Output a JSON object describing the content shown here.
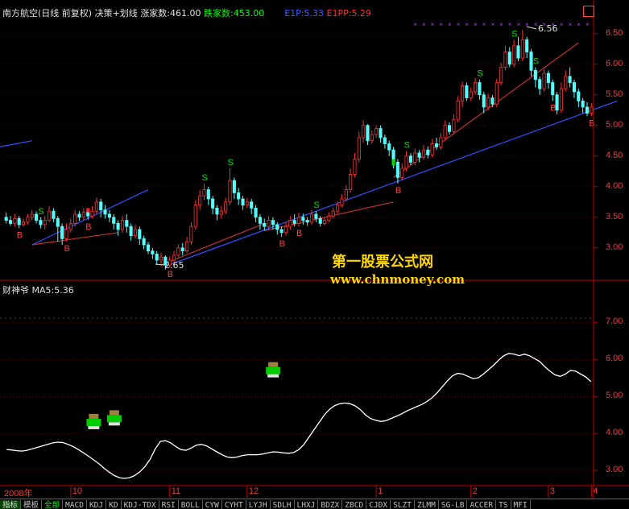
{
  "header": {
    "stock_title": "南方航空(日线 前复权)",
    "indicator_name": "决策+划线",
    "rise_count": "涨家数:461.00",
    "fall_count": "跌家数:453.00",
    "e1p": "E1P:5.33",
    "e1pp": "E1PP:5.29",
    "max_button": "□"
  },
  "sub_header": {
    "indicator": "财神爷",
    "ma_value": "MA5:5.36"
  },
  "watermark": {
    "line1": "第一股票公式网",
    "line2": "www.chnmoney.com"
  },
  "annotations": {
    "high": "6.56",
    "low": "2.65"
  },
  "time_axis": [
    "2008年",
    "10",
    "11",
    "12",
    "1",
    "2",
    "3",
    "4"
  ],
  "tabs": [
    "指标",
    "模板",
    "全部",
    "MACD",
    "KDJ",
    "KD",
    "KDJ-TDX",
    "RSI",
    "BOLL",
    "CYW",
    "CYHT",
    "LYJH",
    "SDLH",
    "LHXJ",
    "BDZX",
    "ZBCD",
    "CJDX",
    "SLZT",
    "ZLMM",
    "SG-LB",
    "ACCER",
    "TS",
    "MFI"
  ],
  "colors": {
    "up": "#ff3333",
    "down": "#54ffff",
    "axis": "#c00000",
    "ma_line": "#ffffff",
    "trend_blue": "#3050ff",
    "trend_red": "#c03030",
    "signal_s": "#00e000",
    "signal_b": "#ff4040"
  },
  "chart_data": [
    {
      "type": "candlestick",
      "title": "",
      "y_ticks": [
        3.0,
        3.5,
        4.0,
        4.5,
        5.0,
        5.5,
        6.0,
        6.5
      ],
      "ylim": [
        2.55,
        6.72
      ],
      "x_ticks": [
        "2008年",
        "10",
        "11",
        "12",
        "1",
        "2",
        "3",
        "4"
      ],
      "candles": [
        [
          3.5,
          3.45,
          3.58,
          3.4
        ],
        [
          3.45,
          3.4,
          3.52,
          3.36
        ],
        [
          3.4,
          3.48,
          3.55,
          3.35
        ],
        [
          3.48,
          3.38,
          3.52,
          3.32
        ],
        [
          3.38,
          3.42,
          3.48,
          3.35
        ],
        [
          3.42,
          3.5,
          3.55,
          3.38
        ],
        [
          3.5,
          3.55,
          3.62,
          3.45
        ],
        [
          3.55,
          3.45,
          3.6,
          3.4
        ],
        [
          3.45,
          3.38,
          3.5,
          3.32
        ],
        [
          3.38,
          3.45,
          3.52,
          3.3
        ],
        [
          3.45,
          3.6,
          3.68,
          3.42
        ],
        [
          3.6,
          3.48,
          3.65,
          3.42
        ],
        [
          3.48,
          3.35,
          3.52,
          3.1
        ],
        [
          3.35,
          3.15,
          3.4,
          3.05
        ],
        [
          3.15,
          3.3,
          3.4,
          3.1
        ],
        [
          3.3,
          3.4,
          3.48,
          3.25
        ],
        [
          3.4,
          3.55,
          3.62,
          3.35
        ],
        [
          3.55,
          3.5,
          3.6,
          3.44
        ],
        [
          3.5,
          3.58,
          3.65,
          3.45
        ],
        [
          3.58,
          3.52,
          3.64,
          3.46
        ],
        [
          3.52,
          3.6,
          3.68,
          3.48
        ],
        [
          3.6,
          3.75,
          3.82,
          3.55
        ],
        [
          3.75,
          3.62,
          3.8,
          3.5
        ],
        [
          3.62,
          3.55,
          3.7,
          3.48
        ],
        [
          3.55,
          3.5,
          3.62,
          3.42
        ],
        [
          3.5,
          3.4,
          3.55,
          3.3
        ],
        [
          3.4,
          3.3,
          3.45,
          3.2
        ],
        [
          3.3,
          3.45,
          3.52,
          3.25
        ],
        [
          3.45,
          3.35,
          3.55,
          3.25
        ],
        [
          3.35,
          3.2,
          3.4,
          3.12
        ],
        [
          3.2,
          3.3,
          3.38,
          3.15
        ],
        [
          3.3,
          3.15,
          3.35,
          3.05
        ],
        [
          3.15,
          3.05,
          3.2,
          2.98
        ],
        [
          3.05,
          2.95,
          3.1,
          2.9
        ],
        [
          2.95,
          2.9,
          3.0,
          2.82
        ],
        [
          2.9,
          2.8,
          2.95,
          2.72
        ],
        [
          2.8,
          2.85,
          2.92,
          2.7
        ],
        [
          2.85,
          2.72,
          2.88,
          2.65
        ],
        [
          2.72,
          2.8,
          2.86,
          2.68
        ],
        [
          2.8,
          2.88,
          2.95,
          2.75
        ],
        [
          2.88,
          3.0,
          3.06,
          2.85
        ],
        [
          3.0,
          2.95,
          3.08,
          2.88
        ],
        [
          2.95,
          3.1,
          3.18,
          2.92
        ],
        [
          3.1,
          3.35,
          3.42,
          3.05
        ],
        [
          3.35,
          3.7,
          3.78,
          3.3
        ],
        [
          3.7,
          3.85,
          3.95,
          3.62
        ],
        [
          3.85,
          3.95,
          4.05,
          3.78
        ],
        [
          3.95,
          3.8,
          4.0,
          3.7
        ],
        [
          3.8,
          3.65,
          3.85,
          3.55
        ],
        [
          3.65,
          3.55,
          3.7,
          3.45
        ],
        [
          3.55,
          3.6,
          3.68,
          3.48
        ],
        [
          3.6,
          3.75,
          3.82,
          3.55
        ],
        [
          3.75,
          4.1,
          4.3,
          3.7
        ],
        [
          4.1,
          3.9,
          4.15,
          3.8
        ],
        [
          3.9,
          3.8,
          3.98,
          3.7
        ],
        [
          3.8,
          3.7,
          3.85,
          3.62
        ],
        [
          3.7,
          3.75,
          3.82,
          3.65
        ],
        [
          3.75,
          3.65,
          3.8,
          3.55
        ],
        [
          3.65,
          3.5,
          3.7,
          3.42
        ],
        [
          3.5,
          3.4,
          3.55,
          3.3
        ],
        [
          3.4,
          3.35,
          3.48,
          3.28
        ],
        [
          3.35,
          3.45,
          3.52,
          3.3
        ],
        [
          3.45,
          3.38,
          3.5,
          3.3
        ],
        [
          3.38,
          3.3,
          3.42,
          3.22
        ],
        [
          3.3,
          3.25,
          3.35,
          3.18
        ],
        [
          3.25,
          3.35,
          3.42,
          3.2
        ],
        [
          3.35,
          3.45,
          3.52,
          3.3
        ],
        [
          3.45,
          3.4,
          3.55,
          3.35
        ],
        [
          3.4,
          3.5,
          3.58,
          3.35
        ],
        [
          3.5,
          3.45,
          3.56,
          3.38
        ],
        [
          3.45,
          3.42,
          3.5,
          3.36
        ],
        [
          3.42,
          3.55,
          3.62,
          3.38
        ],
        [
          3.55,
          3.48,
          3.6,
          3.42
        ],
        [
          3.48,
          3.4,
          3.52,
          3.35
        ],
        [
          3.4,
          3.45,
          3.5,
          3.36
        ],
        [
          3.45,
          3.52,
          3.58,
          3.42
        ],
        [
          3.52,
          3.6,
          3.66,
          3.48
        ],
        [
          3.6,
          3.7,
          3.76,
          3.56
        ],
        [
          3.7,
          3.8,
          3.88,
          3.66
        ],
        [
          3.8,
          3.95,
          4.02,
          3.76
        ],
        [
          3.95,
          4.2,
          4.3,
          3.9
        ],
        [
          4.2,
          4.45,
          4.55,
          4.15
        ],
        [
          4.45,
          4.8,
          4.9,
          4.4
        ],
        [
          4.8,
          5.0,
          5.08,
          4.72
        ],
        [
          5.0,
          4.75,
          5.02,
          4.68
        ],
        [
          4.75,
          4.85,
          4.92,
          4.7
        ],
        [
          4.85,
          4.95,
          5.0,
          4.8
        ],
        [
          4.95,
          4.8,
          5.0,
          4.72
        ],
        [
          4.8,
          4.7,
          4.85,
          4.62
        ],
        [
          4.7,
          4.6,
          4.75,
          4.5
        ],
        [
          4.6,
          4.4,
          4.65,
          4.3
        ],
        [
          4.4,
          4.15,
          4.45,
          4.05
        ],
        [
          4.15,
          4.3,
          4.38,
          4.1
        ],
        [
          4.3,
          4.5,
          4.58,
          4.25
        ],
        [
          4.5,
          4.4,
          4.55,
          4.35
        ],
        [
          4.4,
          4.55,
          4.62,
          4.35
        ],
        [
          4.55,
          4.48,
          4.6,
          4.4
        ],
        [
          4.48,
          4.6,
          4.68,
          4.44
        ],
        [
          4.6,
          4.52,
          4.66,
          4.46
        ],
        [
          4.52,
          4.7,
          4.78,
          4.48
        ],
        [
          4.7,
          4.65,
          4.8,
          4.6
        ],
        [
          4.65,
          4.8,
          4.88,
          4.6
        ],
        [
          4.8,
          5.0,
          5.08,
          4.75
        ],
        [
          5.0,
          4.9,
          5.05,
          4.85
        ],
        [
          4.9,
          5.1,
          5.18,
          4.85
        ],
        [
          5.1,
          5.4,
          5.48,
          5.05
        ],
        [
          5.4,
          5.65,
          5.72,
          5.3
        ],
        [
          5.65,
          5.45,
          5.7,
          5.4
        ],
        [
          5.45,
          5.55,
          5.62,
          5.4
        ],
        [
          5.55,
          5.7,
          5.78,
          5.5
        ],
        [
          5.7,
          5.5,
          5.75,
          5.42
        ],
        [
          5.5,
          5.3,
          5.55,
          5.2
        ],
        [
          5.3,
          5.45,
          5.52,
          5.25
        ],
        [
          5.45,
          5.35,
          5.5,
          5.3
        ],
        [
          5.35,
          5.7,
          5.76,
          5.3
        ],
        [
          5.7,
          5.95,
          6.02,
          5.65
        ],
        [
          5.95,
          6.2,
          6.3,
          5.9
        ],
        [
          6.2,
          6.0,
          6.28,
          5.95
        ],
        [
          6.0,
          6.3,
          6.4,
          5.95
        ],
        [
          6.3,
          6.1,
          6.45,
          6.05
        ],
        [
          6.1,
          6.4,
          6.56,
          6.05
        ],
        [
          6.4,
          6.2,
          6.45,
          6.1
        ],
        [
          6.2,
          5.9,
          6.25,
          5.8
        ],
        [
          5.9,
          5.75,
          5.95,
          5.62
        ],
        [
          5.75,
          5.6,
          5.8,
          5.5
        ],
        [
          5.6,
          5.85,
          5.92,
          5.55
        ],
        [
          5.85,
          5.7,
          5.9,
          5.6
        ],
        [
          5.7,
          5.5,
          5.75,
          5.4
        ],
        [
          5.5,
          5.25,
          5.55,
          5.18
        ],
        [
          5.25,
          5.6,
          5.7,
          5.2
        ],
        [
          5.6,
          5.8,
          5.9,
          5.55
        ],
        [
          5.8,
          5.7,
          5.95,
          5.62
        ],
        [
          5.7,
          5.55,
          5.75,
          5.45
        ],
        [
          5.55,
          5.4,
          5.6,
          5.3
        ],
        [
          5.4,
          5.3,
          5.45,
          5.2
        ],
        [
          5.3,
          5.2,
          5.38,
          5.15
        ],
        [
          5.2,
          5.3,
          5.36,
          5.15
        ]
      ],
      "signals": [
        {
          "i": 3,
          "t": "B"
        },
        {
          "i": 8,
          "t": "S"
        },
        {
          "i": 14,
          "t": "B"
        },
        {
          "i": 19,
          "t": "B"
        },
        {
          "i": 38,
          "t": "B"
        },
        {
          "i": 46,
          "t": "S"
        },
        {
          "i": 52,
          "t": "S"
        },
        {
          "i": 64,
          "t": "B"
        },
        {
          "i": 68,
          "t": "B"
        },
        {
          "i": 72,
          "t": "S"
        },
        {
          "i": 91,
          "t": "B"
        },
        {
          "i": 93,
          "t": "S"
        },
        {
          "i": 110,
          "t": "S"
        },
        {
          "i": 118,
          "t": "S"
        },
        {
          "i": 123,
          "t": "S"
        },
        {
          "i": 127,
          "t": "B"
        },
        {
          "i": 136,
          "t": "B"
        }
      ],
      "trend_lines": [
        {
          "color": "blue",
          "from": [
            0,
            4.65
          ],
          "to": [
            6,
            4.75
          ],
          "from_x_offset": -8
        },
        {
          "color": "blue",
          "from": [
            6,
            3.05
          ],
          "to": [
            33,
            3.95
          ]
        },
        {
          "color": "red",
          "from": [
            6,
            3.05
          ],
          "to": [
            26,
            3.25
          ]
        },
        {
          "color": "red",
          "from": [
            36,
            2.72
          ],
          "to": [
            60,
            3.4
          ]
        },
        {
          "color": "blue",
          "from": [
            37,
            2.7
          ],
          "to": [
            142,
            5.4
          ]
        },
        {
          "color": "red",
          "from": [
            60,
            3.28
          ],
          "to": [
            90,
            3.75
          ]
        },
        {
          "color": "red",
          "from": [
            90,
            4.15
          ],
          "to": [
            133,
            6.35
          ]
        }
      ]
    },
    {
      "type": "line",
      "title": "",
      "y_ticks": [
        3.0,
        4.0,
        5.0,
        6.0,
        7.0
      ],
      "ylim": [
        2.65,
        7.55
      ],
      "values": [
        3.56,
        3.55,
        3.53,
        3.52,
        3.54,
        3.58,
        3.62,
        3.66,
        3.7,
        3.74,
        3.76,
        3.75,
        3.7,
        3.64,
        3.56,
        3.47,
        3.38,
        3.28,
        3.18,
        3.06,
        2.95,
        2.86,
        2.8,
        2.78,
        2.8,
        2.86,
        2.96,
        3.1,
        3.3,
        3.58,
        3.78,
        3.8,
        3.74,
        3.64,
        3.56,
        3.54,
        3.6,
        3.68,
        3.7,
        3.66,
        3.58,
        3.5,
        3.42,
        3.36,
        3.34,
        3.36,
        3.4,
        3.42,
        3.42,
        3.42,
        3.44,
        3.47,
        3.5,
        3.49,
        3.47,
        3.46,
        3.48,
        3.56,
        3.7,
        3.9,
        4.1,
        4.3,
        4.5,
        4.65,
        4.75,
        4.8,
        4.82,
        4.8,
        4.74,
        4.64,
        4.5,
        4.4,
        4.35,
        4.32,
        4.34,
        4.4,
        4.46,
        4.52,
        4.6,
        4.66,
        4.72,
        4.78,
        4.86,
        4.96,
        5.1,
        5.26,
        5.42,
        5.56,
        5.62,
        5.6,
        5.54,
        5.48,
        5.5,
        5.6,
        5.72,
        5.84,
        5.98,
        6.1,
        6.16,
        6.14,
        6.1,
        6.14,
        6.1,
        6.02,
        5.94,
        5.8,
        5.68,
        5.58,
        5.54,
        5.6,
        5.7,
        5.68,
        5.6,
        5.52,
        5.4
      ],
      "icons": [
        {
          "i": 17,
          "v": 4.35
        },
        {
          "i": 21,
          "v": 4.45
        },
        {
          "i": 52,
          "v": 5.75
        }
      ]
    }
  ]
}
